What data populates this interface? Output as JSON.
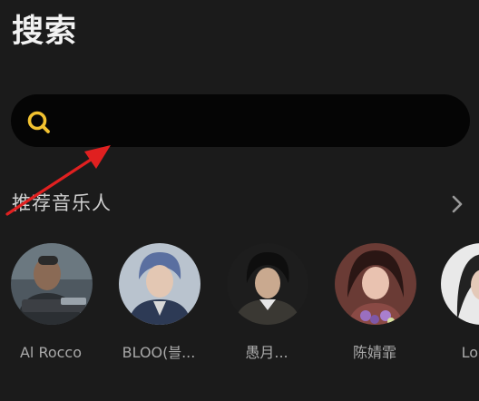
{
  "header": {
    "title": "搜索"
  },
  "search": {
    "placeholder": "",
    "value": ""
  },
  "recommended": {
    "title": "推荐音乐人",
    "artists": [
      {
        "name": "Al Rocco",
        "avatar": "artist-photo"
      },
      {
        "name": "BLOO(블...",
        "avatar": "artist-photo"
      },
      {
        "name": "愚月...",
        "avatar": "artist-photo"
      },
      {
        "name": "陈婧霏",
        "avatar": "artist-photo"
      },
      {
        "name": "Lorde",
        "avatar": "artist-photo"
      }
    ]
  },
  "colors": {
    "background": "#1b1b1b",
    "search_bg": "#050505",
    "accent_icon": "#f2c230",
    "annotation_arrow": "#e02020"
  }
}
